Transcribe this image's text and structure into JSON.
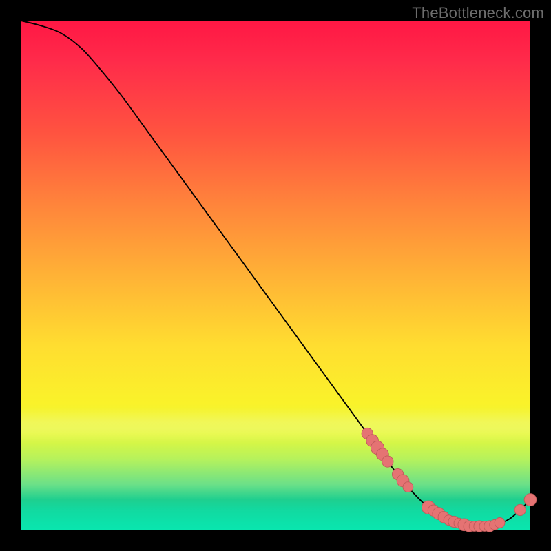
{
  "watermark": "TheBottleneck.com",
  "colors": {
    "background": "#000000",
    "watermark_text": "#6d6d6d",
    "curve_stroke": "#000000",
    "marker_fill": "#e57373",
    "marker_stroke": "#c05a5a"
  },
  "chart_data": {
    "type": "line",
    "title": "",
    "xlabel": "",
    "ylabel": "",
    "xlim": [
      0,
      100
    ],
    "ylim": [
      0,
      100
    ],
    "grid": false,
    "legend": false,
    "x": [
      0,
      4,
      8,
      12,
      16,
      20,
      24,
      28,
      32,
      36,
      40,
      44,
      48,
      52,
      56,
      60,
      64,
      68,
      72,
      76,
      80,
      84,
      88,
      92,
      96,
      100
    ],
    "y": [
      100,
      99,
      97.5,
      94.5,
      90,
      85,
      79.5,
      74,
      68.5,
      63,
      57.5,
      52,
      46.5,
      41,
      35.5,
      30,
      24.5,
      19,
      13.5,
      8.5,
      4.5,
      2,
      0.8,
      0.8,
      2.3,
      6
    ],
    "markers": [
      {
        "x": 68,
        "y": 19.0,
        "r": 1.1
      },
      {
        "x": 69,
        "y": 17.6,
        "r": 1.2
      },
      {
        "x": 70,
        "y": 16.2,
        "r": 1.3
      },
      {
        "x": 71,
        "y": 14.9,
        "r": 1.2
      },
      {
        "x": 72,
        "y": 13.5,
        "r": 1.1
      },
      {
        "x": 74,
        "y": 11.0,
        "r": 1.1
      },
      {
        "x": 75,
        "y": 9.75,
        "r": 1.2
      },
      {
        "x": 76,
        "y": 8.5,
        "r": 1.0
      },
      {
        "x": 80,
        "y": 4.5,
        "r": 1.3
      },
      {
        "x": 81,
        "y": 3.9,
        "r": 1.1
      },
      {
        "x": 82,
        "y": 3.3,
        "r": 1.2
      },
      {
        "x": 83,
        "y": 2.6,
        "r": 1.1
      },
      {
        "x": 84,
        "y": 2.0,
        "r": 1.0
      },
      {
        "x": 85,
        "y": 1.7,
        "r": 1.1
      },
      {
        "x": 86,
        "y": 1.4,
        "r": 1.0
      },
      {
        "x": 87,
        "y": 1.1,
        "r": 1.2
      },
      {
        "x": 88,
        "y": 0.8,
        "r": 1.1
      },
      {
        "x": 89,
        "y": 0.8,
        "r": 1.0
      },
      {
        "x": 90,
        "y": 0.8,
        "r": 1.1
      },
      {
        "x": 91,
        "y": 0.8,
        "r": 1.0
      },
      {
        "x": 92,
        "y": 0.8,
        "r": 1.1
      },
      {
        "x": 93,
        "y": 1.1,
        "r": 1.0
      },
      {
        "x": 94,
        "y": 1.5,
        "r": 1.0
      },
      {
        "x": 98,
        "y": 4.0,
        "r": 1.1
      },
      {
        "x": 100,
        "y": 6.0,
        "r": 1.2
      }
    ],
    "background_gradient": {
      "orientation": "vertical",
      "stops": [
        {
          "pos": 0.0,
          "color": "#ff1744"
        },
        {
          "pos": 0.5,
          "color": "#ffde30"
        },
        {
          "pos": 0.82,
          "color": "#e6f83a"
        },
        {
          "pos": 1.0,
          "color": "#09e6af"
        }
      ]
    }
  }
}
